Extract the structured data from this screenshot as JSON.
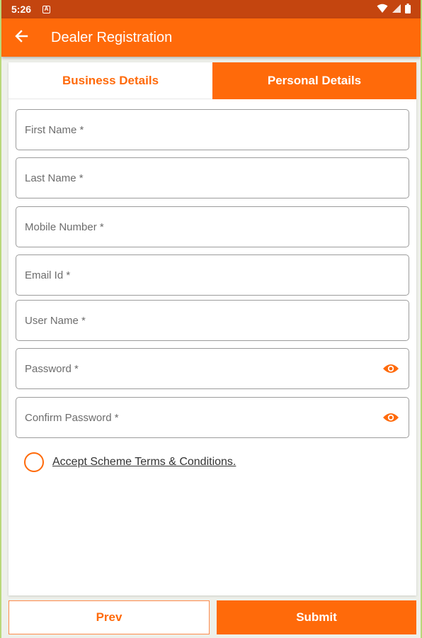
{
  "status_bar": {
    "time": "5:26",
    "notification_icon": "a-badge-icon",
    "icons": [
      "wifi-icon",
      "signal-icon",
      "battery-icon"
    ]
  },
  "app_bar": {
    "title": "Dealer Registration",
    "back_icon": "arrow-left-icon"
  },
  "tabs": [
    {
      "label": "Business Details",
      "active": false
    },
    {
      "label": "Personal Details",
      "active": true
    }
  ],
  "form": {
    "fields": [
      {
        "label": "First Name *"
      },
      {
        "label": "Last Name *"
      },
      {
        "label": "Mobile Number *"
      },
      {
        "label": "Email Id *"
      },
      {
        "label": "User Name *"
      },
      {
        "label": "Password *",
        "icon": "eye-icon"
      },
      {
        "label": "Confirm Password *",
        "icon": "eye-icon"
      }
    ],
    "terms_label": "Accept Scheme Terms & Conditions."
  },
  "buttons": {
    "prev_label": "Prev",
    "submit_label": "Submit"
  },
  "colors": {
    "accent": "#ff6a0a",
    "status_bar": "#c4450f",
    "text_muted": "#6d6d6d"
  }
}
